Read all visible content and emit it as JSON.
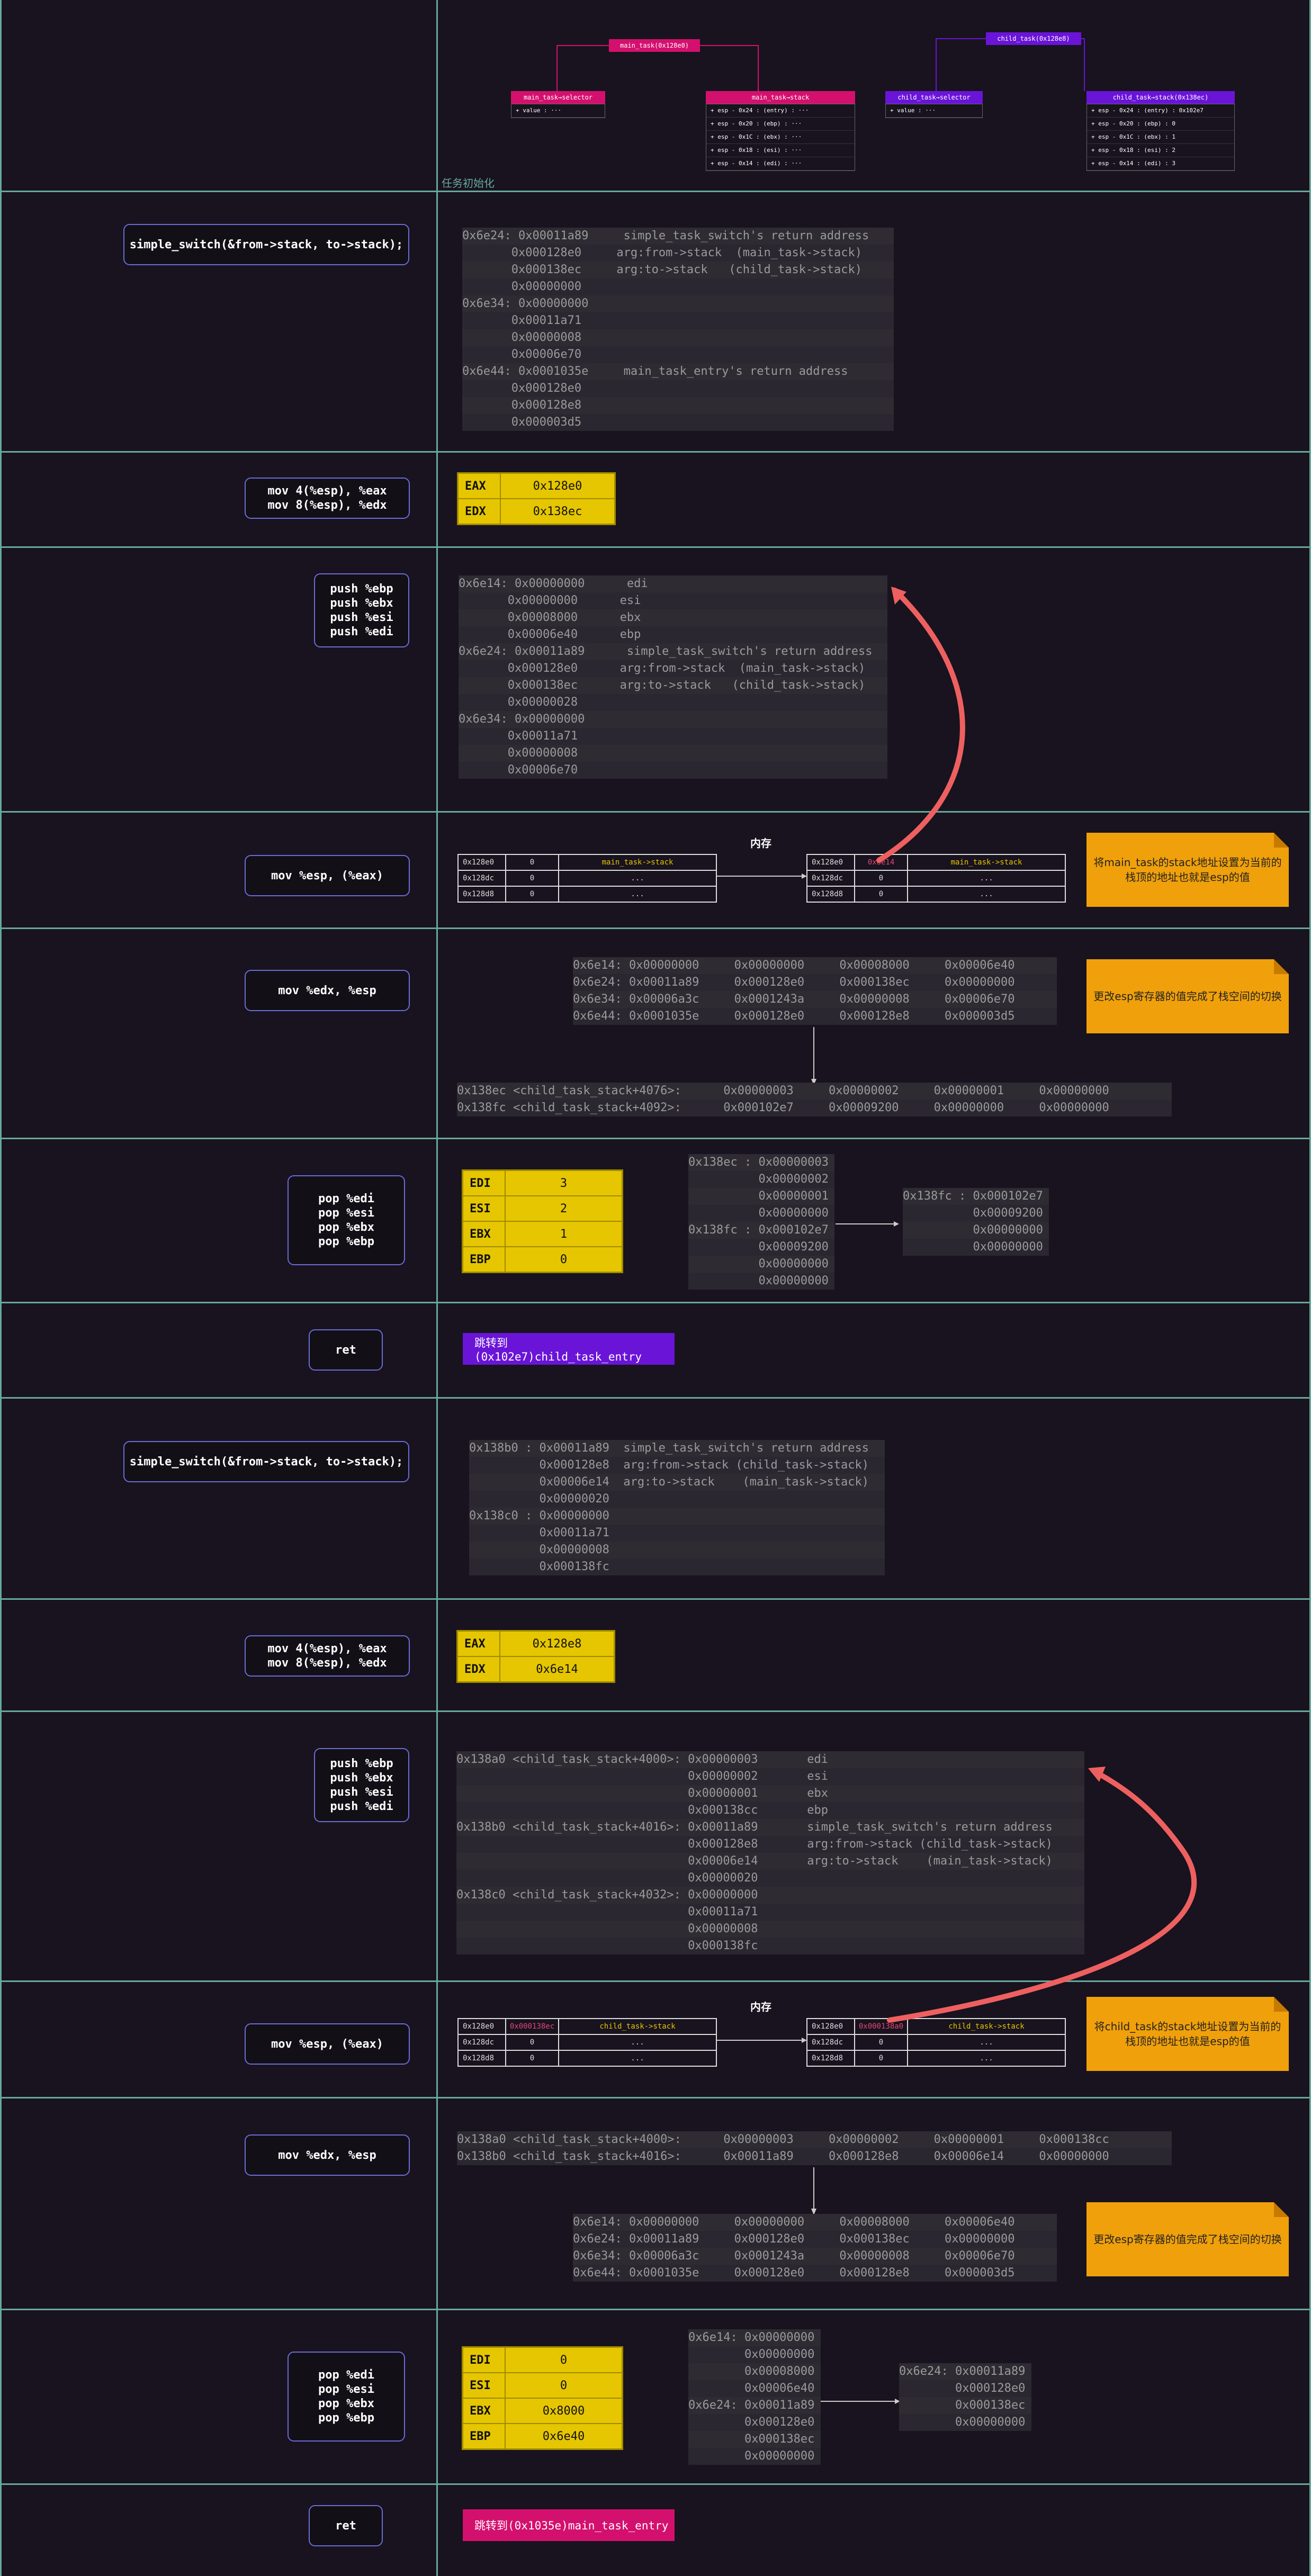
{
  "section1": {
    "caption": "任务初始化",
    "main_task": {
      "title": "main_task(0x128e0)"
    },
    "child_task": {
      "title": "child_task(0x128e8)"
    },
    "main_selector": {
      "title": "main_task→selector",
      "rows": [
        "+ value : ···"
      ]
    },
    "main_stack": {
      "title": "main_task→stack",
      "rows": [
        "+ esp - 0x24 : (entry) : ···",
        "+ esp - 0x20 : (ebp) : ···",
        "+ esp - 0x1C : (ebx) : ···",
        "+ esp - 0x18 : (esi) : ···",
        "+ esp - 0x14 : (edi) : ···"
      ]
    },
    "child_selector": {
      "title": "child_task→selector",
      "rows": [
        "+ value : ···"
      ]
    },
    "child_stack": {
      "title": "child_task→stack(0x138ec)",
      "rows": [
        "+ esp - 0x24 : (entry) : 0x102e7",
        "+ esp - 0x20 : (ebp) : 0",
        "+ esp - 0x1C : (ebx) : 1",
        "+ esp - 0x18 : (esi) : 2",
        "+ esp - 0x14 : (edi) : 3"
      ]
    }
  },
  "rows": {
    "r2": {
      "instr": "simple_switch(&from->stack, to->stack);",
      "stack": [
        "0x6e24: 0x00011a89     simple_task_switch's return address",
        "       0x000128e0     arg:from->stack  (main_task->stack)",
        "       0x000138ec     arg:to->stack   (child_task->stack)",
        "       0x00000000",
        "0x6e34: 0x00000000",
        "       0x00011a71",
        "       0x00000008",
        "       0x00006e70",
        "0x6e44: 0x0001035e     main_task_entry's return address",
        "       0x000128e0",
        "       0x000128e8",
        "       0x000003d5"
      ]
    },
    "r3": {
      "instr": "mov 4(%esp), %eax\nmov 8(%esp), %edx",
      "regs": [
        {
          "n": "EAX",
          "v": "0x128e0"
        },
        {
          "n": "EDX",
          "v": "0x138ec"
        }
      ]
    },
    "r4": {
      "instr": "push %ebp\npush %ebx\npush %esi\npush %edi",
      "stack": [
        "0x6e14: 0x00000000      edi",
        "       0x00000000      esi",
        "       0x00008000      ebx",
        "       0x00006e40      ebp",
        "0x6e24: 0x00011a89      simple_task_switch's return address",
        "       0x000128e0      arg:from->stack  (main_task->stack)",
        "       0x000138ec      arg:to->stack   (child_task->stack)",
        "       0x00000028",
        "0x6e34: 0x00000000",
        "       0x00011a71",
        "       0x00000008",
        "       0x00006e70"
      ]
    },
    "r5": {
      "instr": "mov %esp, (%eax)",
      "mem_title": "内存",
      "mem_left": [
        [
          "0x128e0",
          "0",
          "main_task->stack"
        ],
        [
          "0x128dc",
          "0",
          "..."
        ],
        [
          "0x128d8",
          "0",
          "..."
        ]
      ],
      "mem_right": [
        [
          "0x128e0",
          "0x6e14",
          "main_task->stack"
        ],
        [
          "0x128dc",
          "0",
          "..."
        ],
        [
          "0x128d8",
          "0",
          "..."
        ]
      ],
      "note": "将main_task的stack地址设置为当前的栈顶的地址也就是esp的值"
    },
    "r6": {
      "instr": "mov %edx, %esp",
      "top": [
        "0x6e14: 0x00000000     0x00000000     0x00008000     0x00006e40",
        "0x6e24: 0x00011a89     0x000128e0     0x000138ec     0x00000000",
        "0x6e34: 0x00006a3c     0x0001243a     0x00000008     0x00006e70",
        "0x6e44: 0x0001035e     0x000128e0     0x000128e8     0x000003d5"
      ],
      "bottom": [
        "0x138ec <child_task_stack+4076>:      0x00000003     0x00000002     0x00000001     0x00000000",
        "0x138fc <child_task_stack+4092>:      0x000102e7     0x00009200     0x00000000     0x00000000"
      ],
      "note": "更改esp寄存器的值完成了栈空间的切换"
    },
    "r7": {
      "instr": "pop %edi\npop %esi\npop %ebx\npop %ebp",
      "regs": [
        {
          "n": "EDI",
          "v": "3"
        },
        {
          "n": "ESI",
          "v": "2"
        },
        {
          "n": "EBX",
          "v": "1"
        },
        {
          "n": "EBP",
          "v": "0"
        }
      ],
      "left": [
        "0x138ec : 0x00000003",
        "          0x00000002",
        "          0x00000001",
        "          0x00000000",
        "0x138fc : 0x000102e7",
        "          0x00009200",
        "          0x00000000",
        "          0x00000000"
      ],
      "right": [
        "0x138fc : 0x000102e7",
        "          0x00009200",
        "          0x00000000",
        "          0x00000000"
      ]
    },
    "r8": {
      "instr": "ret",
      "jump": "跳转到(0x102e7)child_task_entry"
    },
    "r9": {
      "instr": "simple_switch(&from->stack, to->stack);",
      "stack": [
        "0x138b0 : 0x00011a89  simple_task_switch's return address",
        "          0x000128e8  arg:from->stack (child_task->stack)",
        "          0x00006e14  arg:to->stack    (main_task->stack)",
        "          0x00000020",
        "0x138c0 : 0x00000000",
        "          0x00011a71",
        "          0x00000008",
        "          0x000138fc"
      ]
    },
    "r10": {
      "instr": "mov 4(%esp), %eax\nmov 8(%esp), %edx",
      "regs": [
        {
          "n": "EAX",
          "v": "0x128e8"
        },
        {
          "n": "EDX",
          "v": "0x6e14"
        }
      ]
    },
    "r11": {
      "instr": "push %ebp\npush %ebx\npush %esi\npush %edi",
      "stack": [
        "0x138a0 <child_task_stack+4000>: 0x00000003       edi",
        "                                 0x00000002       esi",
        "                                 0x00000001       ebx",
        "                                 0x000138cc       ebp",
        "0x138b0 <child_task_stack+4016>: 0x00011a89       simple_task_switch's return address",
        "                                 0x000128e8       arg:from->stack (child_task->stack)",
        "                                 0x00006e14       arg:to->stack    (main_task->stack)",
        "                                 0x00000020",
        "0x138c0 <child_task_stack+4032>: 0x00000000",
        "                                 0x00011a71",
        "                                 0x00000008",
        "                                 0x000138fc"
      ]
    },
    "r12": {
      "instr": "mov %esp, (%eax)",
      "mem_title": "内存",
      "mem_left": [
        [
          "0x128e0",
          "0x000138ec",
          "child_task->stack"
        ],
        [
          "0x128dc",
          "0",
          "..."
        ],
        [
          "0x128d8",
          "0",
          "..."
        ]
      ],
      "mem_right": [
        [
          "0x128e0",
          "0x000138a0",
          "child_task->stack"
        ],
        [
          "0x128dc",
          "0",
          "..."
        ],
        [
          "0x128d8",
          "0",
          "..."
        ]
      ],
      "note": "将child_task的stack地址设置为当前的栈顶的地址也就是esp的值"
    },
    "r13": {
      "instr": "mov %edx, %esp",
      "top": [
        "0x138a0 <child_task_stack+4000>:      0x00000003     0x00000002     0x00000001     0x000138cc",
        "0x138b0 <child_task_stack+4016>:      0x00011a89     0x000128e8     0x00006e14     0x00000000"
      ],
      "bottom": [
        "0x6e14: 0x00000000     0x00000000     0x00008000     0x00006e40",
        "0x6e24: 0x00011a89     0x000128e0     0x000138ec     0x00000000",
        "0x6e34: 0x00006a3c     0x0001243a     0x00000008     0x00006e70",
        "0x6e44: 0x0001035e     0x000128e0     0x000128e8     0x000003d5"
      ],
      "note": "更改esp寄存器的值完成了栈空间的切换"
    },
    "r14": {
      "instr": "pop %edi\npop %esi\npop %ebx\npop %ebp",
      "regs": [
        {
          "n": "EDI",
          "v": "0"
        },
        {
          "n": "ESI",
          "v": "0"
        },
        {
          "n": "EBX",
          "v": "0x8000"
        },
        {
          "n": "EBP",
          "v": "0x6e40"
        }
      ],
      "left": [
        "0x6e14: 0x00000000",
        "        0x00000000",
        "        0x00008000",
        "        0x00006e40",
        "0x6e24: 0x00011a89",
        "        0x000128e0",
        "        0x000138ec",
        "        0x00000000"
      ],
      "right": [
        "0x6e24: 0x00011a89",
        "        0x000128e0",
        "        0x000138ec",
        "        0x00000000"
      ]
    },
    "r15": {
      "instr": "ret",
      "jump": "跳转到(0x1035e)main_task_entry"
    }
  }
}
